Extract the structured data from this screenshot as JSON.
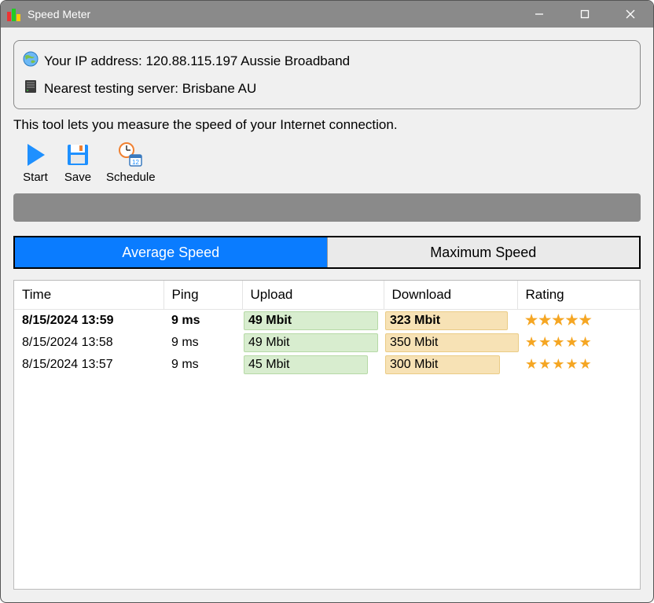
{
  "window": {
    "title": "Speed Meter"
  },
  "info": {
    "ip_line": "Your IP address: 120.88.115.197 Aussie Broadband",
    "server_line": "Nearest testing server: Brisbane AU"
  },
  "description": "This tool lets you measure the speed of your Internet connection.",
  "toolbar": {
    "start": "Start",
    "save": "Save",
    "schedule": "Schedule"
  },
  "tabs": {
    "average": "Average Speed",
    "maximum": "Maximum Speed",
    "active": "average"
  },
  "columns": {
    "time": "Time",
    "ping": "Ping",
    "upload": "Upload",
    "download": "Download",
    "rating": "Rating"
  },
  "rows": [
    {
      "time": "8/15/2024 13:59",
      "ping": "9 ms",
      "upload": "49 Mbit",
      "upload_pct": 95,
      "download": "323 Mbit",
      "download_pct": 92,
      "rating": 5,
      "bold": true
    },
    {
      "time": "8/15/2024 13:58",
      "ping": "9 ms",
      "upload": "49 Mbit",
      "upload_pct": 95,
      "download": "350 Mbit",
      "download_pct": 100,
      "rating": 5,
      "bold": false
    },
    {
      "time": "8/15/2024 13:57",
      "ping": "9 ms",
      "upload": "45 Mbit",
      "upload_pct": 88,
      "download": "300 Mbit",
      "download_pct": 86,
      "rating": 5,
      "bold": false
    }
  ]
}
